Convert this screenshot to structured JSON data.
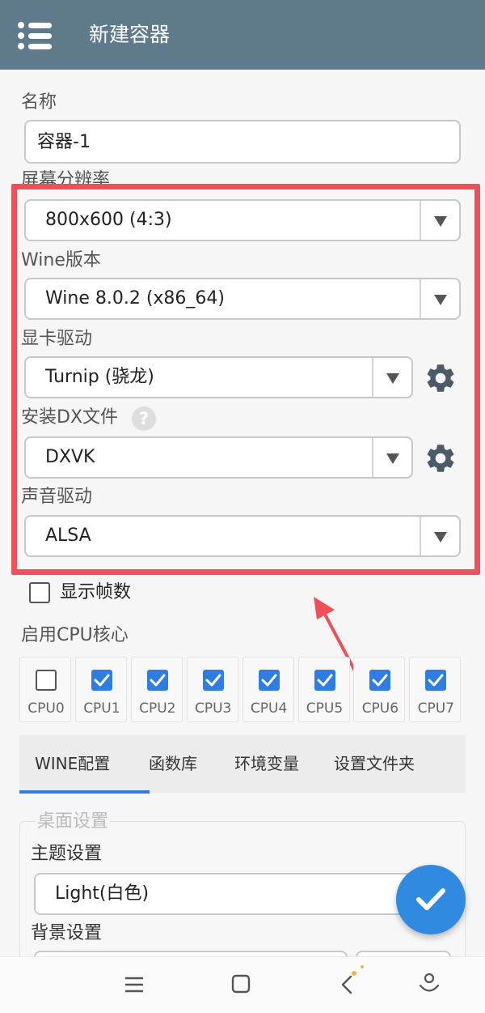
{
  "appbar": {
    "title": "新建容器"
  },
  "form": {
    "name_label": "名称",
    "name_value": "容器-1",
    "resolution_label": "屏幕分辨率",
    "resolution_value": "800x600 (4:3)",
    "wine_label": "Wine版本",
    "wine_value": "Wine 8.0.2 (x86_64)",
    "gpu_label": "显卡驱动",
    "gpu_value": "Turnip (骁龙)",
    "dx_label": "安装DX文件",
    "dx_help": "?",
    "dx_value": "DXVK",
    "audio_label": "声音驱动",
    "audio_value": "ALSA",
    "show_fps_label": "显示帧数",
    "show_fps_checked": false
  },
  "cpu": {
    "label": "启用CPU核心",
    "cores": [
      {
        "name": "CPU0",
        "checked": false
      },
      {
        "name": "CPU1",
        "checked": true
      },
      {
        "name": "CPU2",
        "checked": true
      },
      {
        "name": "CPU3",
        "checked": true
      },
      {
        "name": "CPU4",
        "checked": true
      },
      {
        "name": "CPU5",
        "checked": true
      },
      {
        "name": "CPU6",
        "checked": true
      },
      {
        "name": "CPU7",
        "checked": true
      }
    ]
  },
  "tabs": [
    "WINE配置",
    "函数库",
    "环境变量",
    "设置文件夹"
  ],
  "desktop": {
    "section_label": "桌面设置",
    "theme_label": "主题设置",
    "theme_value": "Light(白色)",
    "background_label": "背景设置"
  },
  "colors": {
    "appbar": "#5f7a8a",
    "accent": "#2f7de1",
    "highlight": "#ef4f58"
  },
  "icons": [
    "menu-icon",
    "dropdown-caret-icon",
    "gear-icon",
    "help-icon",
    "checkmark-icon",
    "arrow-annotation-icon",
    "nav-menu-icon",
    "nav-home-icon",
    "nav-back-icon",
    "nav-assistant-icon"
  ]
}
